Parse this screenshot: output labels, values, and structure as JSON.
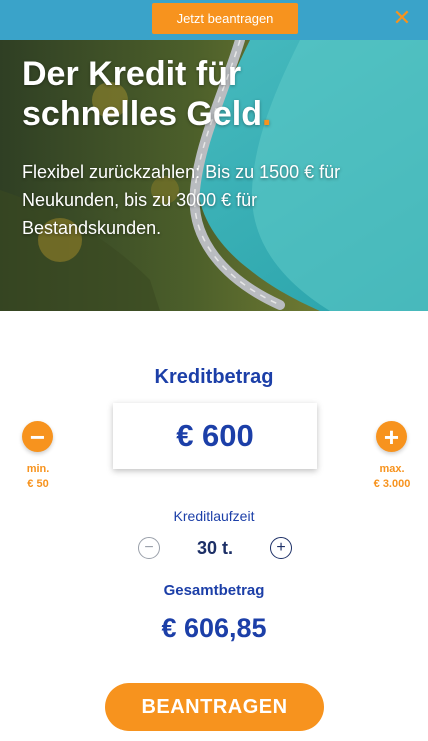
{
  "topbar": {
    "cta_label": "Jetzt beantragen",
    "close_icon": "close-icon",
    "background": "#3aa3c9",
    "accent": "#f7931e"
  },
  "hero": {
    "title_line1": "Der Kredit für",
    "title_line2": "schnelles Geld",
    "title_dot": ".",
    "subtitle": "Flexibel zurückzahlen: Bis zu 1500 € für Neukunden, bis zu 3000 € für Bestandskunden."
  },
  "calculator": {
    "title": "Kreditbetrag",
    "minus_icon": "minus-icon",
    "plus_icon": "plus-icon",
    "amount": "€ 600",
    "min_label": "min.",
    "min_value": "€ 50",
    "max_label": "max.",
    "max_value": "€ 3.000",
    "term_label": "Kreditlaufzeit",
    "term_value": "30 t.",
    "total_label": "Gesamtbetrag",
    "total_value": "€ 606,85",
    "apply_label": "BEANTRAGEN"
  },
  "colors": {
    "brand_blue": "#1c3fa8",
    "brand_orange": "#f7931e"
  }
}
